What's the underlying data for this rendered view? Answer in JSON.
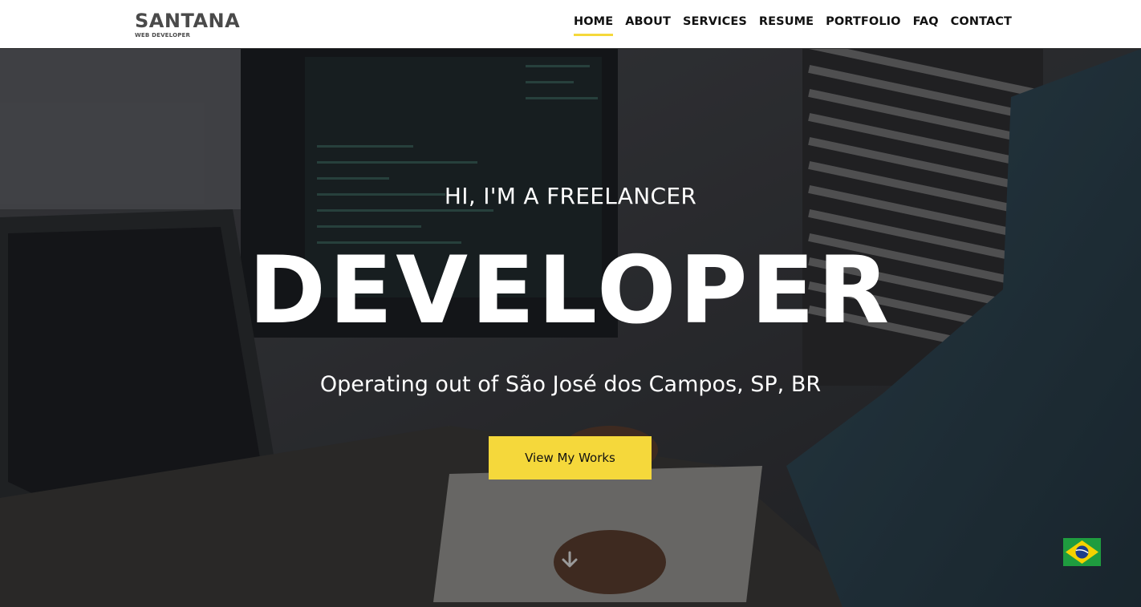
{
  "brand": {
    "name": "SANTANA",
    "tagline": "WEB DEVELOPER"
  },
  "nav": {
    "items": [
      {
        "label": "HOME",
        "active": true
      },
      {
        "label": "ABOUT",
        "active": false
      },
      {
        "label": "SERVICES",
        "active": false
      },
      {
        "label": "RESUME",
        "active": false
      },
      {
        "label": "PORTFOLIO",
        "active": false
      },
      {
        "label": "FAQ",
        "active": false
      },
      {
        "label": "CONTACT",
        "active": false
      }
    ]
  },
  "hero": {
    "greeting": "HI, I'M A FREELANCER",
    "title": "DEVELOPER",
    "location": "Operating out of São José dos Campos, SP, BR",
    "cta_label": "View My Works",
    "scroll_icon": "arrow-down-icon",
    "language_flag": "brazil-flag-icon"
  },
  "colors": {
    "accent": "#f5d83b",
    "header_bg": "#ffffff",
    "hero_text": "#ffffff"
  }
}
